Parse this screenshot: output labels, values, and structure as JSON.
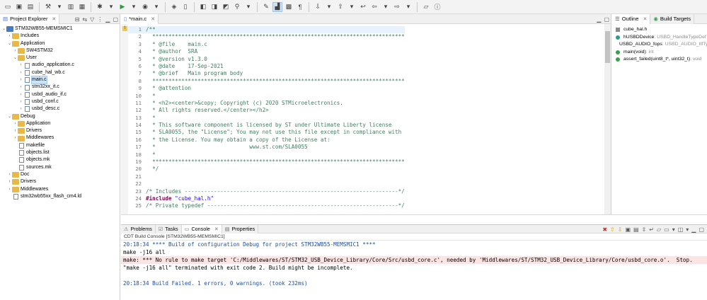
{
  "project_explorer": {
    "tab_label": "Project Explorer",
    "tree": [
      {
        "label": "STM32WB55-MEMSMIC1",
        "type": "project",
        "depth": 0,
        "expanded": true
      },
      {
        "label": "Includes",
        "type": "folder",
        "depth": 1,
        "expanded": false
      },
      {
        "label": "Application",
        "type": "folder",
        "depth": 1,
        "expanded": true
      },
      {
        "label": "SW4STM32",
        "type": "folder",
        "depth": 2,
        "expanded": false
      },
      {
        "label": "User",
        "type": "folder",
        "depth": 2,
        "expanded": true
      },
      {
        "label": "audio_application.c",
        "type": "cfile",
        "depth": 3,
        "expanded": false
      },
      {
        "label": "cube_hal_wb.c",
        "type": "cfile",
        "depth": 3,
        "expanded": false
      },
      {
        "label": "main.c",
        "type": "cfile",
        "depth": 3,
        "expanded": false,
        "selected": true
      },
      {
        "label": "stm32xx_it.c",
        "type": "cfile",
        "depth": 3,
        "expanded": false
      },
      {
        "label": "usbd_audio_if.c",
        "type": "cfile",
        "depth": 3,
        "expanded": false
      },
      {
        "label": "usbd_conf.c",
        "type": "cfile",
        "depth": 3,
        "expanded": false
      },
      {
        "label": "usbd_desc.c",
        "type": "cfile",
        "depth": 3,
        "expanded": false
      },
      {
        "label": "Debug",
        "type": "folder",
        "depth": 1,
        "expanded": true
      },
      {
        "label": "Application",
        "type": "folder",
        "depth": 2,
        "expanded": false
      },
      {
        "label": "Drivers",
        "type": "folder",
        "depth": 2,
        "expanded": false
      },
      {
        "label": "Middlewares",
        "type": "folder",
        "depth": 2,
        "expanded": false
      },
      {
        "label": "makefile",
        "type": "file",
        "depth": 2,
        "leaf": true
      },
      {
        "label": "objects.list",
        "type": "file",
        "depth": 2,
        "leaf": true
      },
      {
        "label": "objects.mk",
        "type": "file",
        "depth": 2,
        "leaf": true
      },
      {
        "label": "sources.mk",
        "type": "file",
        "depth": 2,
        "leaf": true
      },
      {
        "label": "Doc",
        "type": "folder",
        "depth": 1,
        "expanded": false
      },
      {
        "label": "Drivers",
        "type": "folder",
        "depth": 1,
        "expanded": false
      },
      {
        "label": "Middlewares",
        "type": "folder",
        "depth": 1,
        "expanded": false
      },
      {
        "label": "stm32wb55xx_flash_cm4.ld",
        "type": "file",
        "depth": 1,
        "leaf": true
      }
    ]
  },
  "editor": {
    "tab_label": "*main.c",
    "lines": [
      {
        "n": "1",
        "text": "/**",
        "cls": "comment"
      },
      {
        "n": "2",
        "text": "  ******************************************************************************",
        "cls": "comment"
      },
      {
        "n": "3",
        "text": "  * @file    main.c",
        "cls": "comment"
      },
      {
        "n": "4",
        "text": "  * @author  SRA",
        "cls": "comment"
      },
      {
        "n": "5",
        "text": "  * @version v1.3.0",
        "cls": "comment"
      },
      {
        "n": "6",
        "text": "  * @date    17-Sep-2021",
        "cls": "comment"
      },
      {
        "n": "7",
        "text": "  * @brief   Main program body",
        "cls": "comment"
      },
      {
        "n": "8",
        "text": "  ******************************************************************************",
        "cls": "comment"
      },
      {
        "n": "9",
        "text": "  * @attention",
        "cls": "comment"
      },
      {
        "n": "10",
        "text": "  *",
        "cls": "comment"
      },
      {
        "n": "11",
        "text": "  * <h2><center>&copy; Copyright (c) 2020 STMicroelectronics.",
        "cls": "comment"
      },
      {
        "n": "12",
        "text": "  * All rights reserved.</center></h2>",
        "cls": "comment"
      },
      {
        "n": "13",
        "text": "  *",
        "cls": "comment"
      },
      {
        "n": "14",
        "text": "  * This software component is licensed by ST under Ultimate Liberty license",
        "cls": "comment"
      },
      {
        "n": "15",
        "text": "  * SLA0055, the \"License\"; You may not use this file except in compliance with",
        "cls": "comment"
      },
      {
        "n": "16",
        "text": "  * the License. You may obtain a copy of the License at:",
        "cls": "comment"
      },
      {
        "n": "17",
        "text": "  *                             www.st.com/SLA0055",
        "cls": "comment"
      },
      {
        "n": "18",
        "text": "  *",
        "cls": "comment"
      },
      {
        "n": "19",
        "text": "  ******************************************************************************",
        "cls": "comment"
      },
      {
        "n": "20",
        "text": "  */",
        "cls": "comment"
      },
      {
        "n": "21",
        "text": "",
        "cls": ""
      },
      {
        "n": "22",
        "text": "",
        "cls": ""
      },
      {
        "n": "23",
        "text": "/* Includes ------------------------------------------------------------------*/",
        "cls": "comment"
      },
      {
        "n": "24",
        "kw": "#include ",
        "str": "\"cube_hal.h\"",
        "cls": "include"
      },
      {
        "n": "25",
        "text": "/* Private typedef -----------------------------------------------------------*/",
        "cls": "comment"
      }
    ]
  },
  "outline": {
    "tab_label": "Outline",
    "tab2_label": "Build Targets",
    "items": [
      {
        "name": "cube_hal.h",
        "detail": "",
        "icon": "include-icon",
        "color": "#8a8a8a"
      },
      {
        "name": "hUSBDDevice",
        "detail": " : USBD_HandleTypeDef",
        "icon": "variable-icon",
        "color": "#2a9d8f"
      },
      {
        "name": "USBD_AUDIO_fops",
        "detail": " : USBD_AUDIO_ItfTypeDef",
        "icon": "variable-icon",
        "color": "#2a9d8f"
      },
      {
        "name": "main(void)",
        "detail": " : int",
        "icon": "function-icon",
        "color": "#3aa04a"
      },
      {
        "name": "assert_failed(uint8_t*, uint32_t)",
        "detail": " : void",
        "icon": "function-icon",
        "color": "#3aa04a"
      }
    ]
  },
  "console": {
    "tabs": [
      "Problems",
      "Tasks",
      "Console",
      "Properties"
    ],
    "active_tab": "Console",
    "subtitle": "CDT Build Console [STM32WB55-MEMSMIC1]",
    "lines": [
      {
        "text": "20:18:34 **** Build of configuration Debug for project STM32WB55-MEMSMIC1 ****",
        "cls": "blue"
      },
      {
        "text": "make -j16 all",
        "cls": ""
      },
      {
        "text": "make: *** No rule to make target 'C:/Middlewares/ST/STM32_USB_Device_Library/Core/Src/usbd_core.c', needed by 'Middlewares/ST/STM32_USB_Device_Library/Core/usbd_core.o'.  Stop.",
        "cls": "err"
      },
      {
        "text": "\"make -j16 all\" terminated with exit code 2. Build might be incomplete.",
        "cls": ""
      },
      {
        "text": "",
        "cls": ""
      },
      {
        "text": "20:18:34 Build Failed. 1 errors, 0 warnings. (took 232ms)",
        "cls": "blue"
      }
    ]
  }
}
